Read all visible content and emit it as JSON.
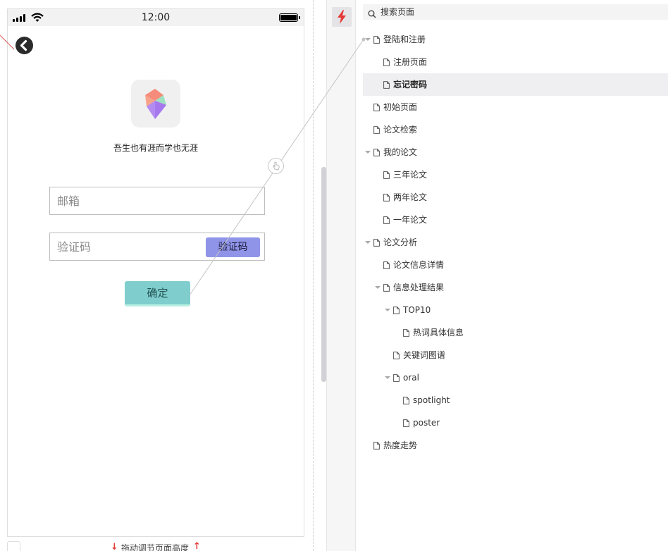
{
  "status_bar": {
    "time": "12:00"
  },
  "login": {
    "tagline": "吾生也有涯而学也无涯",
    "email_placeholder": "邮箱",
    "code_placeholder": "验证码",
    "code_button": "验证码",
    "confirm_button": "确定"
  },
  "resize_hint": "拖动调节页面高度",
  "sidebar": {
    "search_placeholder": "搜索页面"
  },
  "tree": [
    {
      "label": "登陆和注册",
      "level": 0,
      "expanded": true,
      "selected": false
    },
    {
      "label": "注册页面",
      "level": 1,
      "expanded": false,
      "selected": false
    },
    {
      "label": "忘记密码",
      "level": 1,
      "expanded": false,
      "selected": true
    },
    {
      "label": "初始页面",
      "level": 0,
      "expanded": false,
      "selected": false
    },
    {
      "label": "论文检索",
      "level": 0,
      "expanded": false,
      "selected": false
    },
    {
      "label": "我的论文",
      "level": 0,
      "expanded": true,
      "selected": false
    },
    {
      "label": "三年论文",
      "level": 1,
      "expanded": false,
      "selected": false
    },
    {
      "label": "两年论文",
      "level": 1,
      "expanded": false,
      "selected": false
    },
    {
      "label": "一年论文",
      "level": 1,
      "expanded": false,
      "selected": false
    },
    {
      "label": "论文分析",
      "level": 0,
      "expanded": true,
      "selected": false
    },
    {
      "label": "论文信息详情",
      "level": 1,
      "expanded": false,
      "selected": false
    },
    {
      "label": "信息处理结果",
      "level": 1,
      "expanded": true,
      "selected": false
    },
    {
      "label": "TOP10",
      "level": 2,
      "expanded": true,
      "selected": false
    },
    {
      "label": "热词具体信息",
      "level": 3,
      "expanded": false,
      "selected": false
    },
    {
      "label": "关键词图谱",
      "level": 2,
      "expanded": false,
      "selected": false
    },
    {
      "label": "oral",
      "level": 2,
      "expanded": true,
      "selected": false
    },
    {
      "label": "spotlight",
      "level": 3,
      "expanded": false,
      "selected": false
    },
    {
      "label": "poster",
      "level": 3,
      "expanded": false,
      "selected": false
    },
    {
      "label": "热度走势",
      "level": 0,
      "expanded": false,
      "selected": false
    }
  ],
  "colors": {
    "accent_red": "#e53935",
    "confirm": "#80cdcd",
    "code_button": "#8f94e8",
    "selected_row": "#efeff1"
  },
  "icons": [
    "signal-icon",
    "wifi-icon",
    "battery-icon",
    "back-icon",
    "app-logo-icon",
    "bolt-icon",
    "search-icon",
    "page-icon",
    "caret-down-icon",
    "touch-icon"
  ]
}
